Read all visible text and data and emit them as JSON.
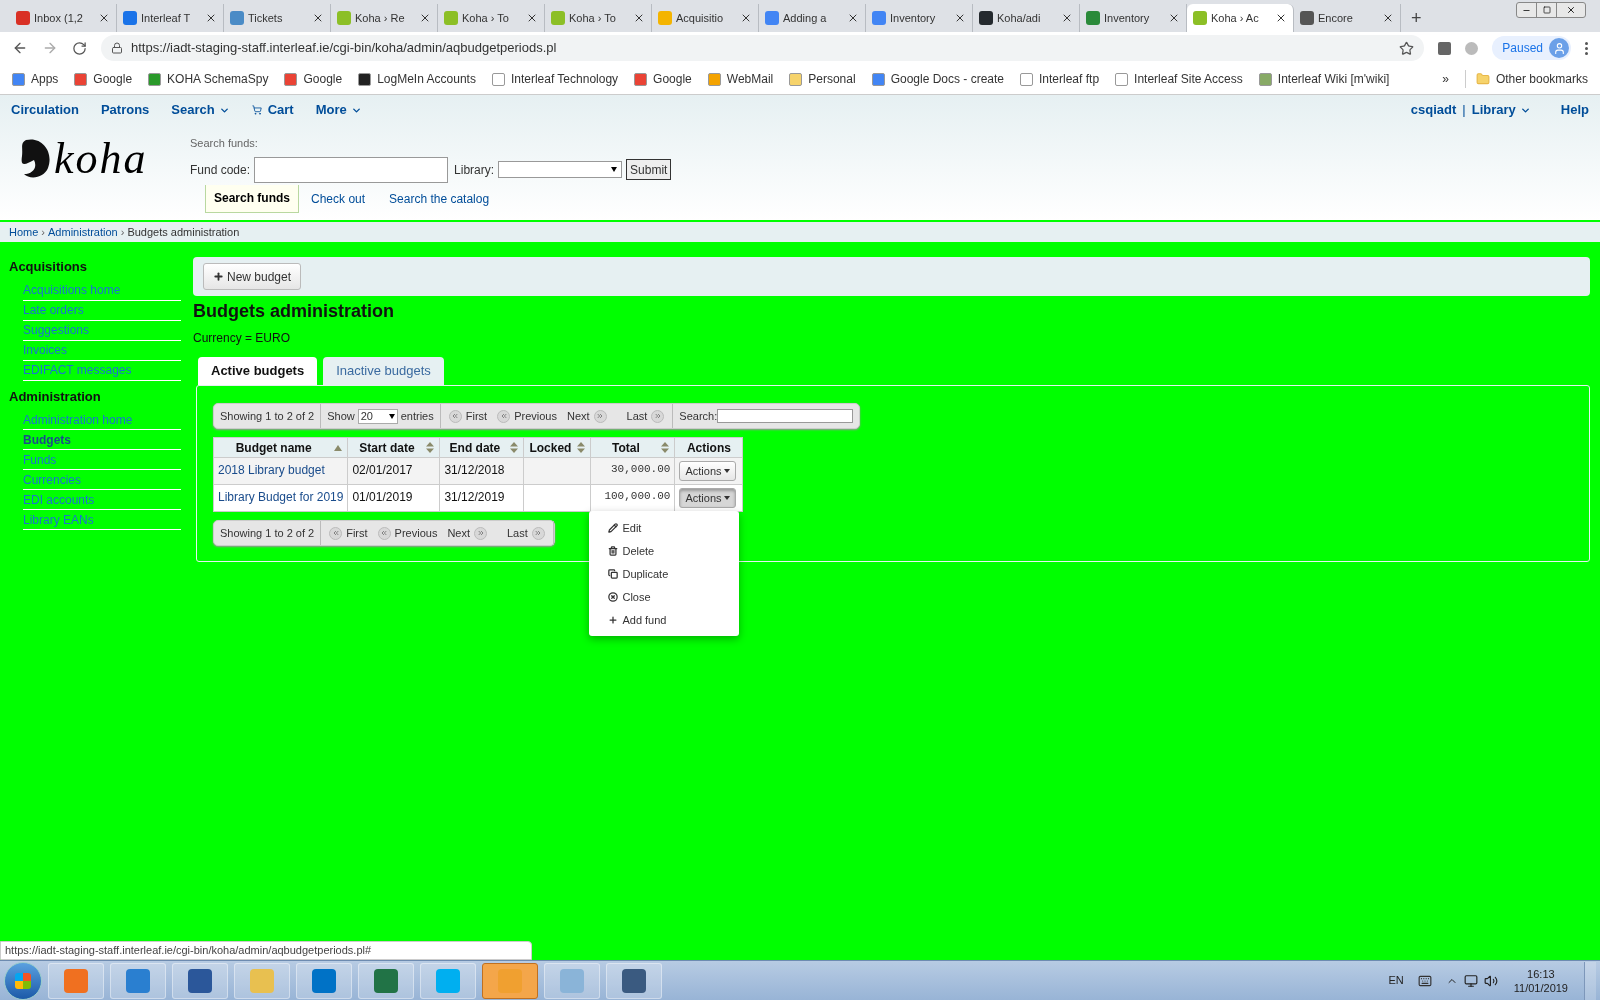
{
  "browser": {
    "tabs": [
      {
        "title": "Inbox (1,2",
        "selected": false
      },
      {
        "title": "Interleaf T",
        "selected": false
      },
      {
        "title": "Tickets",
        "selected": false
      },
      {
        "title": "Koha › Re",
        "selected": false
      },
      {
        "title": "Koha › To",
        "selected": false
      },
      {
        "title": "Koha › To",
        "selected": false
      },
      {
        "title": "Acquisitio",
        "selected": false
      },
      {
        "title": "Adding a",
        "selected": false
      },
      {
        "title": "Inventory",
        "selected": false
      },
      {
        "title": "Koha/adi",
        "selected": false
      },
      {
        "title": "Inventory",
        "selected": false
      },
      {
        "title": "Koha › Ac",
        "selected": true
      },
      {
        "title": "Encore",
        "selected": false
      }
    ],
    "new_tab": "+",
    "address": "https://iadt-staging-staff.interleaf.ie/cgi-bin/koha/admin/aqbudgetperiods.pl",
    "profile": "Paused",
    "bookmarks": [
      "Apps",
      "Google",
      "KOHA SchemaSpy",
      "Google",
      "LogMeIn Accounts",
      "Interleaf Technology",
      "Google",
      "WebMail",
      "Personal",
      "Google Docs - create",
      "Interleaf ftp",
      "Interleaf Site Access",
      "Interleaf Wiki [m'wiki]"
    ],
    "bookmarks_more": "»",
    "other_bookmarks": "Other bookmarks"
  },
  "koha_nav": {
    "items": [
      {
        "label": "Circulation",
        "kind": "link"
      },
      {
        "label": "Patrons",
        "kind": "link"
      },
      {
        "label": "Search",
        "kind": "dropdown"
      },
      {
        "label": "Cart",
        "kind": "cart"
      },
      {
        "label": "More",
        "kind": "dropdown"
      }
    ],
    "user": "csqiadt",
    "separator": "|",
    "library": "Library",
    "help": "Help"
  },
  "logo_text": "koha",
  "search_header": {
    "heading": "Search funds:",
    "fund_code_label": "Fund code:",
    "library_label": "Library:",
    "submit": "Submit",
    "tabs": [
      {
        "label": "Search funds",
        "selected": true
      },
      {
        "label": "Check out",
        "selected": false
      },
      {
        "label": "Search the catalog",
        "selected": false
      }
    ]
  },
  "breadcrumb": {
    "items": [
      "Home",
      "Administration",
      "Budgets administration"
    ],
    "separator": "›"
  },
  "sidebar": {
    "sections": [
      {
        "title": "Acquisitions",
        "items": [
          {
            "label": "Acquisitions home",
            "selected": false
          },
          {
            "label": "Late orders",
            "selected": false
          },
          {
            "label": "Suggestions",
            "selected": false
          },
          {
            "label": "Invoices",
            "selected": false
          },
          {
            "label": "EDIFACT messages",
            "selected": false
          }
        ]
      },
      {
        "title": "Administration",
        "items": [
          {
            "label": "Administration home",
            "selected": false
          },
          {
            "label": "Budgets",
            "selected": true
          },
          {
            "label": "Funds",
            "selected": false
          },
          {
            "label": "Currencies",
            "selected": false
          },
          {
            "label": "EDI accounts",
            "selected": false
          },
          {
            "label": "Library EANs",
            "selected": false
          }
        ]
      }
    ]
  },
  "toolbar": {
    "new_budget": "New budget"
  },
  "page": {
    "title": "Budgets administration",
    "currency": "Currency = EURO"
  },
  "tabs": [
    {
      "label": "Active budgets",
      "selected": true
    },
    {
      "label": "Inactive budgets",
      "selected": false
    }
  ],
  "table_top": {
    "info": "Showing 1 to 2 of 2",
    "show": "Show",
    "page_size": "20",
    "entries": "entries",
    "first": "First",
    "previous": "Previous",
    "next": "Next",
    "last": "Last",
    "search_label": "Search:"
  },
  "table": {
    "columns": [
      {
        "label": "Budget name",
        "sorted": true
      },
      {
        "label": "Start date",
        "sorted": false
      },
      {
        "label": "End date",
        "sorted": false
      },
      {
        "label": "Locked",
        "sorted": false
      },
      {
        "label": "Total",
        "sorted": false
      },
      {
        "label": "Actions"
      }
    ],
    "rows": [
      {
        "name": "2018 Library budget",
        "start": "02/01/2017",
        "end": "31/12/2018",
        "total": "30,000.00",
        "actions": "Actions",
        "expanded": false
      },
      {
        "name": "Library Budget for 2019",
        "start": "01/01/2019",
        "end": "31/12/2019",
        "total": "100,000.00",
        "actions": "Actions",
        "expanded": true
      }
    ]
  },
  "table_bottom": {
    "info": "Showing 1 to 2 of 2",
    "first": "First",
    "previous": "Previous",
    "next": "Next",
    "last": "Last"
  },
  "actions_menu": {
    "items": [
      "Edit",
      "Delete",
      "Duplicate",
      "Close",
      "Add fund"
    ]
  },
  "status_url": "https://iadt-staging-staff.interleaf.ie/cgi-bin/koha/admin/aqbudgetperiods.pl#",
  "taskbar": {
    "language": "EN",
    "time": "16:13",
    "date": "11/01/2019"
  }
}
